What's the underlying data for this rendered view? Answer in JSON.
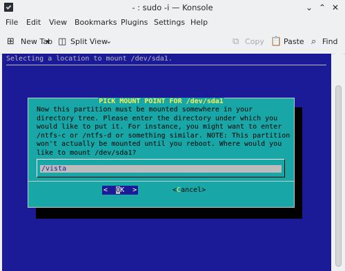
{
  "window": {
    "title": "- : sudo -i — Konsole",
    "controls": {
      "minimize": "⌄",
      "maximize": "⌃",
      "close": "✕"
    }
  },
  "menubar": {
    "items": [
      "File",
      "Edit",
      "View",
      "Bookmarks",
      "Plugins",
      "Settings",
      "Help"
    ]
  },
  "toolbar": {
    "new_tab": "New Tab",
    "split_view": "Split View",
    "copy": "Copy",
    "paste": "Paste",
    "find": "Find"
  },
  "terminal": {
    "status_line": "Selecting a location to mount /dev/sda1.",
    "dialog": {
      "title": "PICK MOUNT POINT FOR /dev/sda1",
      "body": "Now this partition must be mounted somewhere in your\ndirectory tree. Please enter the directory under which you\nwould like to put it. For instance, you might want to enter\n/ntfs-c or /ntfs-d or something similar. NOTE: This partition\nwon't actually be mounted until you reboot. Where would you\nlike to mount /dev/sda1?",
      "input_value": "/vista",
      "ok_left": "<  ",
      "ok_hot": "O",
      "ok_rest": "K  >",
      "cancel_left": "<",
      "cancel_hot": "C",
      "cancel_rest": "ancel>"
    }
  },
  "colors": {
    "terminal_bg": "#1b1b97",
    "dialog_bg": "#18a6a6",
    "dialog_title": "#f1f15a"
  }
}
